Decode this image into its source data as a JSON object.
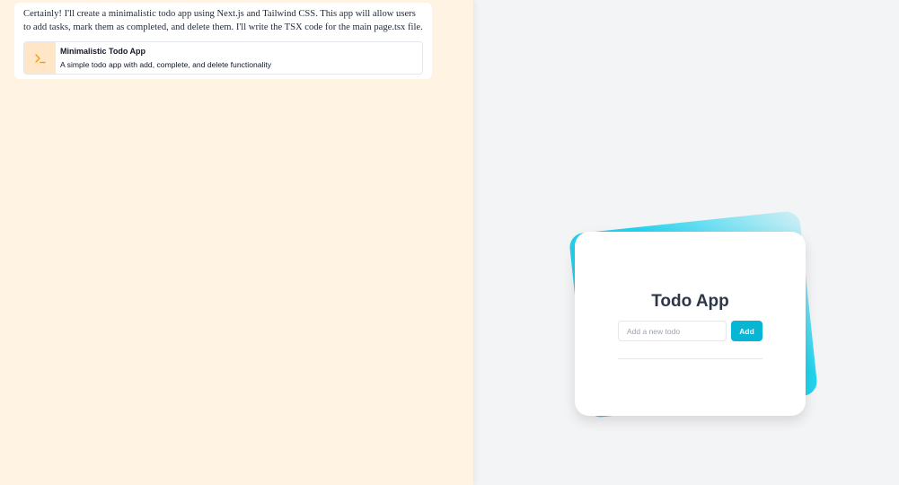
{
  "chat": {
    "message": "Certainly! I'll create a minimalistic todo app using Next.js and Tailwind CSS. This app will allow users to add tasks, mark them as completed, and delete them. I'll write the TSX code for the main page.tsx file.",
    "artifact": {
      "icon": "terminal-icon",
      "title": "Minimalistic Todo App",
      "description": "A simple todo app with add, complete, and delete functionality"
    }
  },
  "preview": {
    "title": "Todo App",
    "input_placeholder": "Add a new todo",
    "input_value": "",
    "add_label": "Add"
  },
  "colors": {
    "left_bg": "#fff3e4",
    "right_bg": "#f3f4f6",
    "accent": "#06b6d4",
    "accent_back": "#22d3ee",
    "artifact_icon_bg": "#ffe6c6",
    "artifact_icon_fg": "#f59e0b"
  }
}
